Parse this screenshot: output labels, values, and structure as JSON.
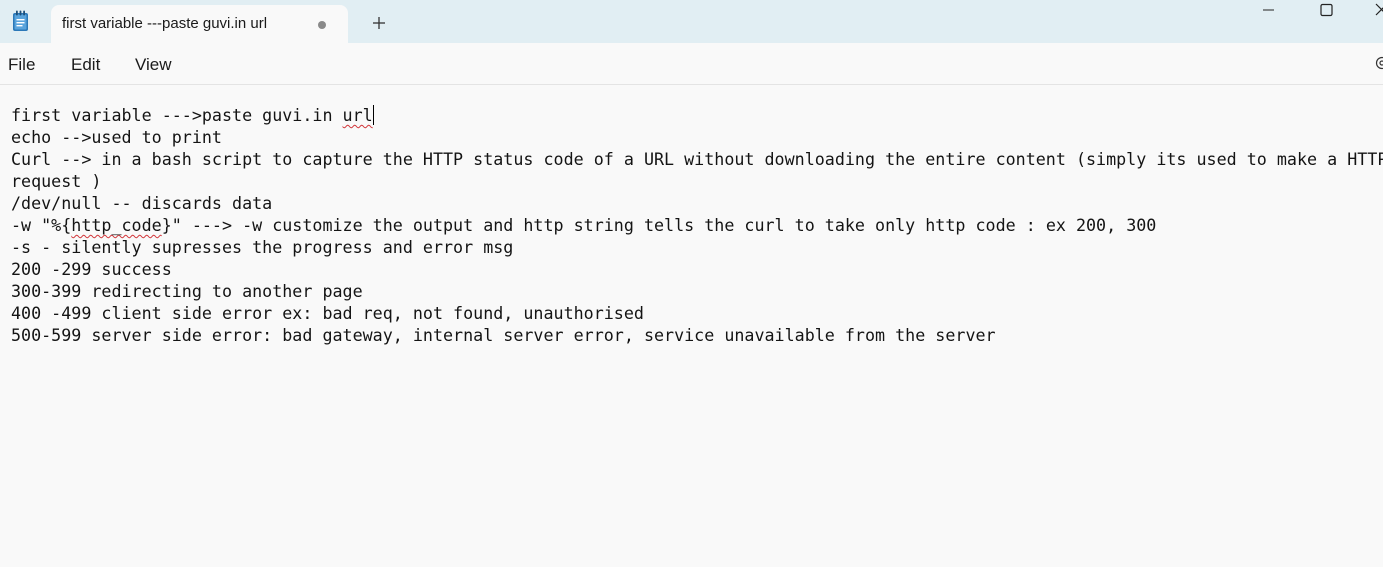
{
  "window": {
    "tab_title": "first variable ---paste guvi.in url",
    "tab_status": "unsaved-dot",
    "new_tab_icon": "plus-icon",
    "app_icon": "notepad-icon"
  },
  "menu": {
    "file": "File",
    "edit": "Edit",
    "view": "View"
  },
  "editor": {
    "lines": [
      {
        "parts": [
          "first variable --->paste guvi.in ",
          "url",
          ""
        ]
      },
      {
        "text": "echo -->used to print"
      },
      {
        "text": "Curl --> in a bash script to capture the HTTP status code of a URL without downloading the entire content (simply its used to make a HTTP"
      },
      {
        "text": "request )"
      },
      {
        "text": "/dev/null -- discards data"
      },
      {
        "parts": [
          "-w \"%{",
          "http_code",
          "}\" ---> -w customize the output and http string tells the curl to take only http code : ex 200, 300"
        ]
      },
      {
        "text": "-s - silently supresses the progress and error msg"
      },
      {
        "text": "200 -299 success"
      },
      {
        "text": "300-399 redirecting to another page"
      },
      {
        "text": "400 -499 client side error ex: bad req, not found, unauthorised"
      },
      {
        "text": "500-599 server side error: bad gateway, internal server error, service unavailable from the server"
      }
    ]
  },
  "colors": {
    "titlebar_bg": "#e1eef3",
    "editor_bg": "#f9f9f9",
    "spellcheck": "#d13438",
    "app_icon": "#2b78b8"
  }
}
